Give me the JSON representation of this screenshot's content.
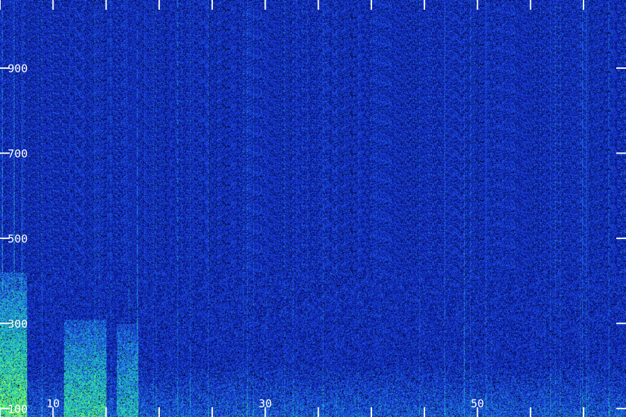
{
  "chart_data": {
    "type": "heatmap",
    "title": "",
    "xlabel": "",
    "ylabel": "",
    "xlim": [
      5,
      64
    ],
    "ylim": [
      80,
      1060
    ],
    "x_ticks": [
      10,
      30,
      50
    ],
    "x_tick_labels": [
      "10",
      "30",
      "50"
    ],
    "x_minor_ticks": [
      5,
      10,
      15,
      20,
      25,
      30,
      35,
      40,
      45,
      50,
      55,
      60
    ],
    "y_ticks": [
      100,
      300,
      500,
      700,
      900
    ],
    "y_tick_labels": [
      "100",
      "300",
      "500",
      "700",
      "900"
    ],
    "grid": false,
    "colormap": [
      "#000000",
      "#000a50",
      "#0a1c9e",
      "#1e46e6",
      "#1ea0d2",
      "#28e6a0",
      "#b4ff32"
    ],
    "background_level": 0.42,
    "low_band": {
      "y_range": [
        80,
        200
      ],
      "level": 0.62
    },
    "hotspots": [
      {
        "x_range": [
          5,
          7.5
        ],
        "y_range": [
          80,
          420
        ],
        "level": 0.98
      },
      {
        "x_range": [
          11,
          15
        ],
        "y_range": [
          80,
          310
        ],
        "level": 0.88
      },
      {
        "x_range": [
          16,
          18
        ],
        "y_range": [
          80,
          300
        ],
        "level": 0.8
      }
    ],
    "vertical_lines": [
      {
        "x": 5.2,
        "level": 0.9
      },
      {
        "x": 6.3,
        "level": 0.88
      },
      {
        "x": 7.0,
        "level": 0.85
      },
      {
        "x": 17.9,
        "level": 0.82
      },
      {
        "x": 17.1,
        "level": 0.72
      },
      {
        "x": 14.3,
        "level": 0.66
      },
      {
        "x": 48.7,
        "level": 0.8
      }
    ]
  }
}
